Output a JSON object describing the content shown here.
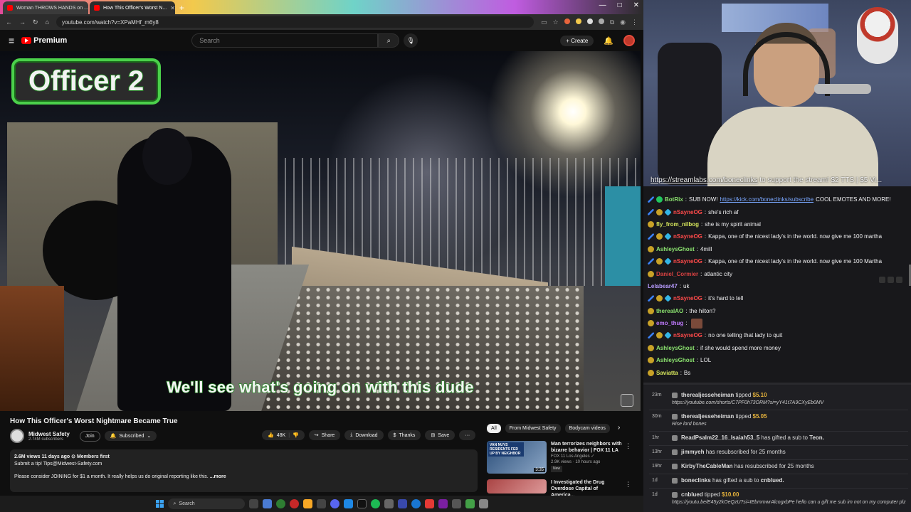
{
  "browser": {
    "tabs": [
      {
        "label": "Woman THROWS HANDS on ..."
      },
      {
        "label": "How This Officer's Worst N..."
      }
    ],
    "new_tab": "+",
    "window_controls": [
      "—",
      "□",
      "✕"
    ],
    "url": "youtube.com/watch?v=XPaMHf_m6y8"
  },
  "youtube": {
    "logo_text": "Premium",
    "search_placeholder": "Search",
    "create_label": "Create",
    "video": {
      "overlay_label": "Officer 2",
      "subtitle": "We'll see what's going on with this dude",
      "title": "How This Officer's Worst Nightmare Became True"
    },
    "channel": {
      "name": "Midwest Safety",
      "subs": "2.74M subscribers",
      "join": "Join",
      "subscribed": "Subscribed"
    },
    "actions": {
      "likes": "48K",
      "share": "Share",
      "download": "Download",
      "thanks": "Thanks",
      "save": "Save",
      "more": "···"
    },
    "description": {
      "meta": "2.6M views  11 days ago  ⊙ Members first",
      "line1": "Submit a tip! Tips@Midwest-Safety.com",
      "line2": "Please consider JOINING for $1 a month. It really helps us do original reporting like this.",
      "more": "...more"
    },
    "chips": [
      "All",
      "From Midwest Safety",
      "Bodycam videos"
    ],
    "recs": [
      {
        "thumb_text": "VAN NUYS RESIDENTS FED UP BY NEIGHBOR",
        "duration": "3:35",
        "title": "Man terrorizes neighbors with bizarre behavior | FOX 11 LA",
        "channel": "FOX 11 Los Angeles ✓",
        "views": "2.9K views · 10 hours ago",
        "badge": "New"
      },
      {
        "thumb_text": "",
        "title": "I Investigated the Drug Overdose Capital of America...",
        "channel": "",
        "views": ""
      }
    ]
  },
  "taskbar": {
    "search": "Search"
  },
  "stream": {
    "ticker_link": "https://streamlabs.com/boneclinks",
    "ticker_text": "to support the stream! $2 TTS | $5 Vi..."
  },
  "chat": [
    {
      "user": "BotRix",
      "color": "#8be26f",
      "text": "SUB NOW!",
      "link": "https://kick.com/boneclinks/subscribe",
      "after": "COOL EMOTES AND MORE!",
      "badges": [
        "sword",
        "check"
      ]
    },
    {
      "user": "nSayneOG",
      "color": "#ff4a4a",
      "text": "she's rich af",
      "badges": [
        "sword",
        "coin",
        "gem"
      ]
    },
    {
      "user": "fly_from_nilbog",
      "color": "#d6e65c",
      "text": "she is my spirit animal",
      "badges": [
        "coin"
      ]
    },
    {
      "user": "nSayneOG",
      "color": "#ff4a4a",
      "text": "Kappa, one of the nicest lady's in the world. now give me 100 martha",
      "badges": [
        "sword",
        "coin",
        "gem"
      ]
    },
    {
      "user": "AshleysGhost",
      "color": "#8be26f",
      "text": "4mill",
      "badges": [
        "coin"
      ]
    },
    {
      "user": "nSayneOG",
      "color": "#ff4a4a",
      "text": "Kappa, one of the nicest lady's in the world. now give me 100 Martha",
      "badges": [
        "sword",
        "coin",
        "gem"
      ]
    },
    {
      "user": "Daniel_Cormier",
      "color": "#d94242",
      "text": "atlantic city",
      "badges": [
        "coin"
      ]
    },
    {
      "user": "Lelabear47",
      "color": "#b89cff",
      "text": "uk",
      "badges": []
    },
    {
      "user": "nSayneOG",
      "color": "#ff4a4a",
      "text": "it's hard to tell",
      "badges": [
        "sword",
        "coin",
        "gem"
      ]
    },
    {
      "user": "therealAO",
      "color": "#8be26f",
      "text": "the hilton?",
      "badges": [
        "coin"
      ]
    },
    {
      "user": "emo_thug",
      "color": "#c07aff",
      "text": "",
      "emote": true,
      "badges": [
        "coin"
      ]
    },
    {
      "user": "nSayneOG",
      "color": "#ff4a4a",
      "text": "no one telling that lady to quit",
      "badges": [
        "sword",
        "coin",
        "gem"
      ]
    },
    {
      "user": "AshleysGhost",
      "color": "#8be26f",
      "text": "if she would spend more money",
      "badges": [
        "coin"
      ]
    },
    {
      "user": "AshleysGhost",
      "color": "#8be26f",
      "text": "LOL",
      "badges": [
        "coin"
      ]
    },
    {
      "user": "Saviatta",
      "color": "#d6e65c",
      "text": "Bs",
      "badges": [
        "coin"
      ]
    }
  ],
  "events": [
    {
      "time": "23m",
      "user": "therealjesseheiman",
      "action": "tipped",
      "amount": "$5.10",
      "note": "https://youtube.com/shorts/C7PF0h73ORM?si=yY41t7A9CXyEb0MV"
    },
    {
      "time": "30m",
      "user": "therealjesseheiman",
      "action": "tipped",
      "amount": "$5.05",
      "note": "Rise lord bones"
    },
    {
      "time": "1hr",
      "user": "ReadPsalm22_16_Isaiah53_5",
      "action": "has gifted a sub to",
      "target": "Teon."
    },
    {
      "time": "13hr",
      "user": "jimmyeh",
      "action": "has resubscribed for 25 months"
    },
    {
      "time": "19hr",
      "user": "KirbyTheCableMan",
      "action": "has resubscribed for 25 months"
    },
    {
      "time": "1d",
      "user": "boneclinks",
      "action": "has gifted a sub to",
      "target": "cnblued."
    },
    {
      "time": "1d",
      "user": "cnblued",
      "action": "tipped",
      "amount": "$10.00",
      "note": "https://youtu.be/E45y2kOeQzU?si=IEbmmwrAlcogxbPe hello can u gift me sub im not on my computer plz"
    }
  ]
}
